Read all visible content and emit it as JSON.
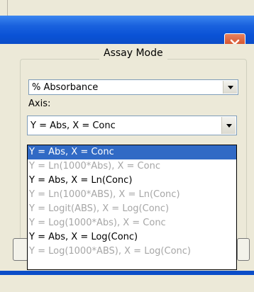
{
  "dialog": {
    "close_icon": "close-x-icon",
    "group_title": "Assay Mode"
  },
  "mode_select": {
    "value": "% Absorbance",
    "arrow_icon": "chevron-down-icon"
  },
  "axis": {
    "label": "Axis:",
    "value": "Y = Abs, X = Conc",
    "arrow_icon": "chevron-down-icon"
  },
  "axis_options": [
    {
      "label": "Y = Abs, X = Conc",
      "state": "selected"
    },
    {
      "label": "Y = Ln(1000*Abs), X = Conc",
      "state": "dim"
    },
    {
      "label": "Y = Abs, X = Ln(Conc)",
      "state": "normal"
    },
    {
      "label": "Y = Ln(1000*ABS), X = Ln(Conc)",
      "state": "dim"
    },
    {
      "label": "Y = Logit(ABS), X = Log(Conc)",
      "state": "dim"
    },
    {
      "label": "Y = Log(1000*Abs), X = Conc",
      "state": "dim"
    },
    {
      "label": "Y = Abs, X = Log(Conc)",
      "state": "normal"
    },
    {
      "label": "Y = Log(1000*ABS), X = Log(Conc)",
      "state": "dim"
    }
  ],
  "colors": {
    "titlebar": "#0b4dc8",
    "selection": "#316ac5",
    "close_button": "#d5532c",
    "dim_text": "#a6a6a6"
  }
}
